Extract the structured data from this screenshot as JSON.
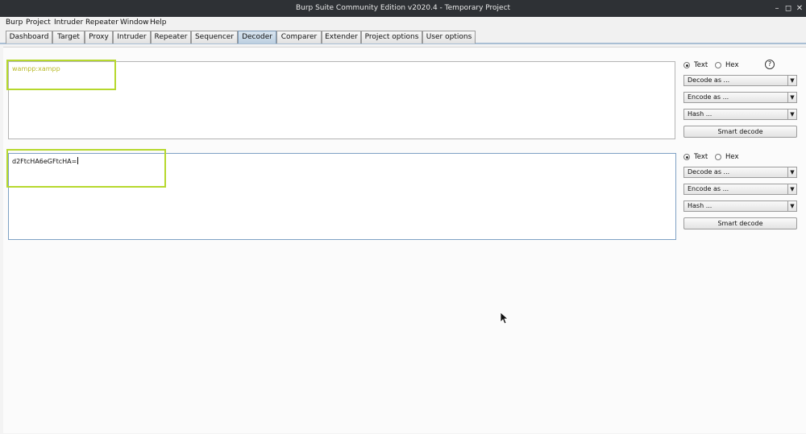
{
  "window": {
    "title": "Burp Suite Community Edition v2020.4 - Temporary Project",
    "minimize_label": "–",
    "maximize_label": "◻",
    "close_label": "✕"
  },
  "menu": [
    "Burp",
    "Project",
    "Intruder",
    "Repeater",
    "Window",
    "Help"
  ],
  "tabs": [
    "Dashboard",
    "Target",
    "Proxy",
    "Intruder",
    "Repeater",
    "Sequencer",
    "Decoder",
    "Comparer",
    "Extender",
    "Project options",
    "User options"
  ],
  "active_tab": "Decoder",
  "decoder": {
    "panels": [
      {
        "content": "wampp:xampp",
        "mode": "Text",
        "radio_text": "Text",
        "radio_hex": "Hex",
        "decode_as": "Decode as ...",
        "encode_as": "Encode as ...",
        "hash": "Hash ...",
        "smart_decode": "Smart decode",
        "help": "?"
      },
      {
        "content": "d2FtcHA6eGFtcHA=",
        "mode": "Text",
        "radio_text": "Text",
        "radio_hex": "Hex",
        "decode_as": "Decode as ...",
        "encode_as": "Encode as ...",
        "hash": "Hash ...",
        "smart_decode": "Smart decode"
      }
    ]
  },
  "colors": {
    "highlight_box": "#b6d82d",
    "input_text": "#b9ba25",
    "active_tab": "#bccfe0",
    "titlebar": "#2e3135"
  },
  "icons": {
    "dropdown": "chevron-down-icon",
    "help": "help-icon",
    "cursor": "mouse-pointer-icon"
  }
}
